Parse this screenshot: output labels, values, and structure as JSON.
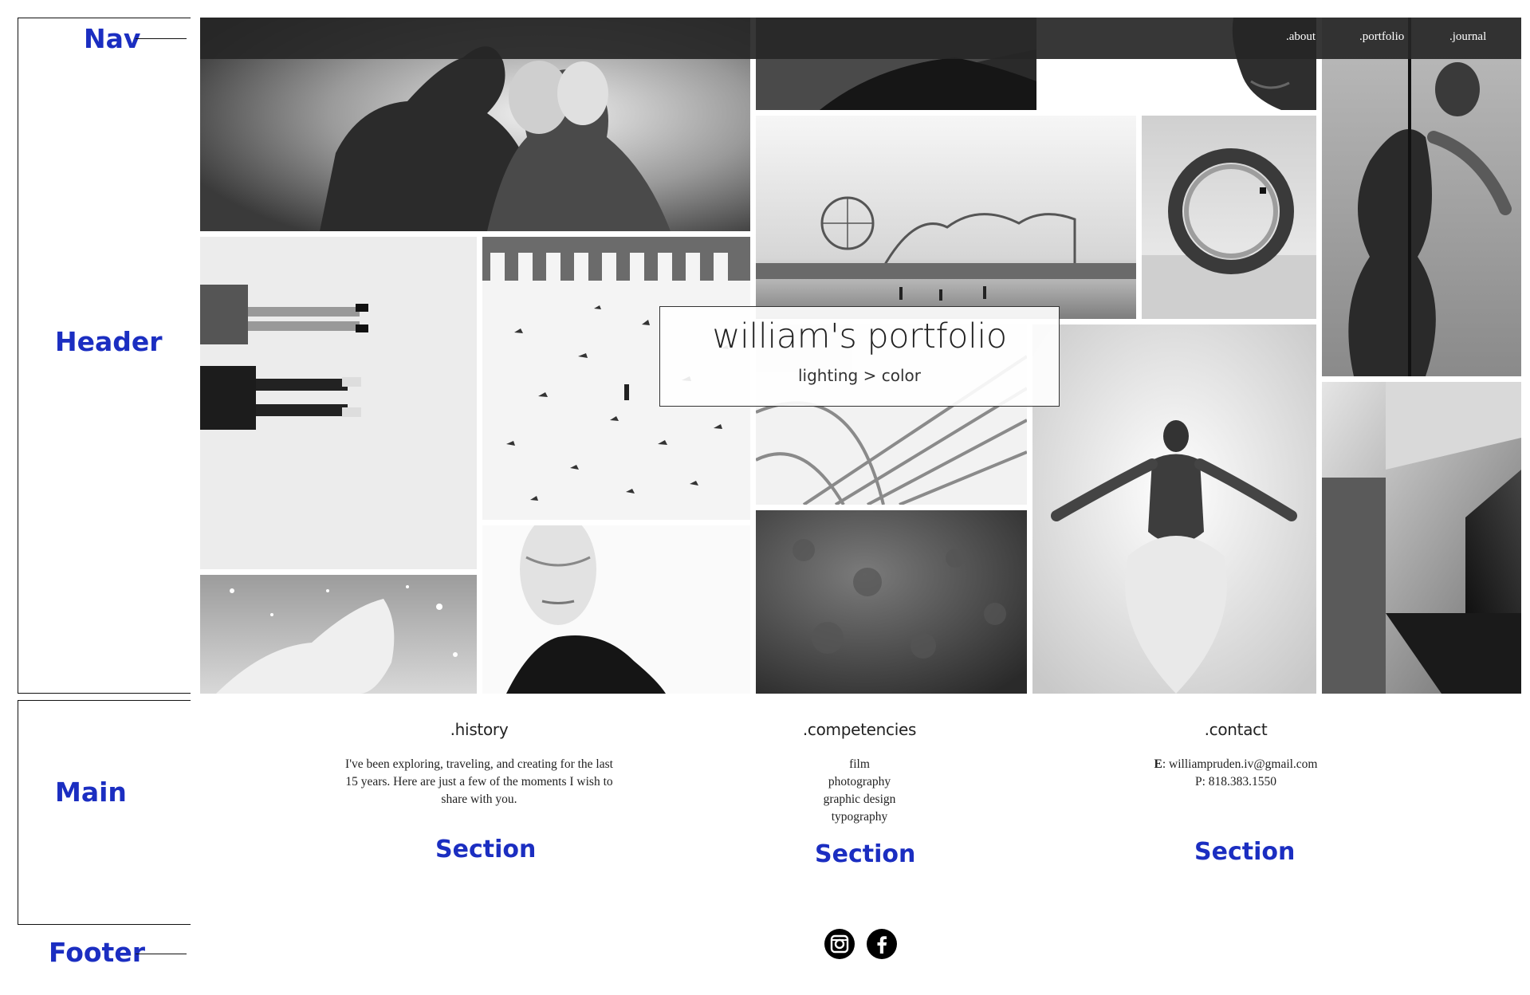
{
  "annotations": {
    "nav": "Nav",
    "header": "Header",
    "main": "Main",
    "footer": "Footer",
    "section": "Section"
  },
  "nav": {
    "links": [
      ".about",
      ".portfolio",
      ".journal"
    ]
  },
  "header": {
    "title": "william's portfolio",
    "tagline": "lighting > color"
  },
  "main": {
    "history": {
      "heading": ".history",
      "lines": [
        "I've been exploring, traveling, and creating for the last",
        "15 years. Here are just a few of the moments I wish to",
        "share with you."
      ]
    },
    "competencies": {
      "heading": ".competencies",
      "items": [
        "film",
        "photography",
        "graphic design",
        "typography"
      ]
    },
    "contact": {
      "heading": ".contact",
      "email_label": "E",
      "email": "williampruden.iv@gmail.com",
      "phone_label": "P",
      "phone": "818.383.1550"
    }
  },
  "footer": {
    "icons": [
      "instagram-icon",
      "facebook-icon"
    ]
  },
  "colors": {
    "annotation": "#1b2ec1",
    "navbar": "#262626",
    "text": "#222222"
  }
}
